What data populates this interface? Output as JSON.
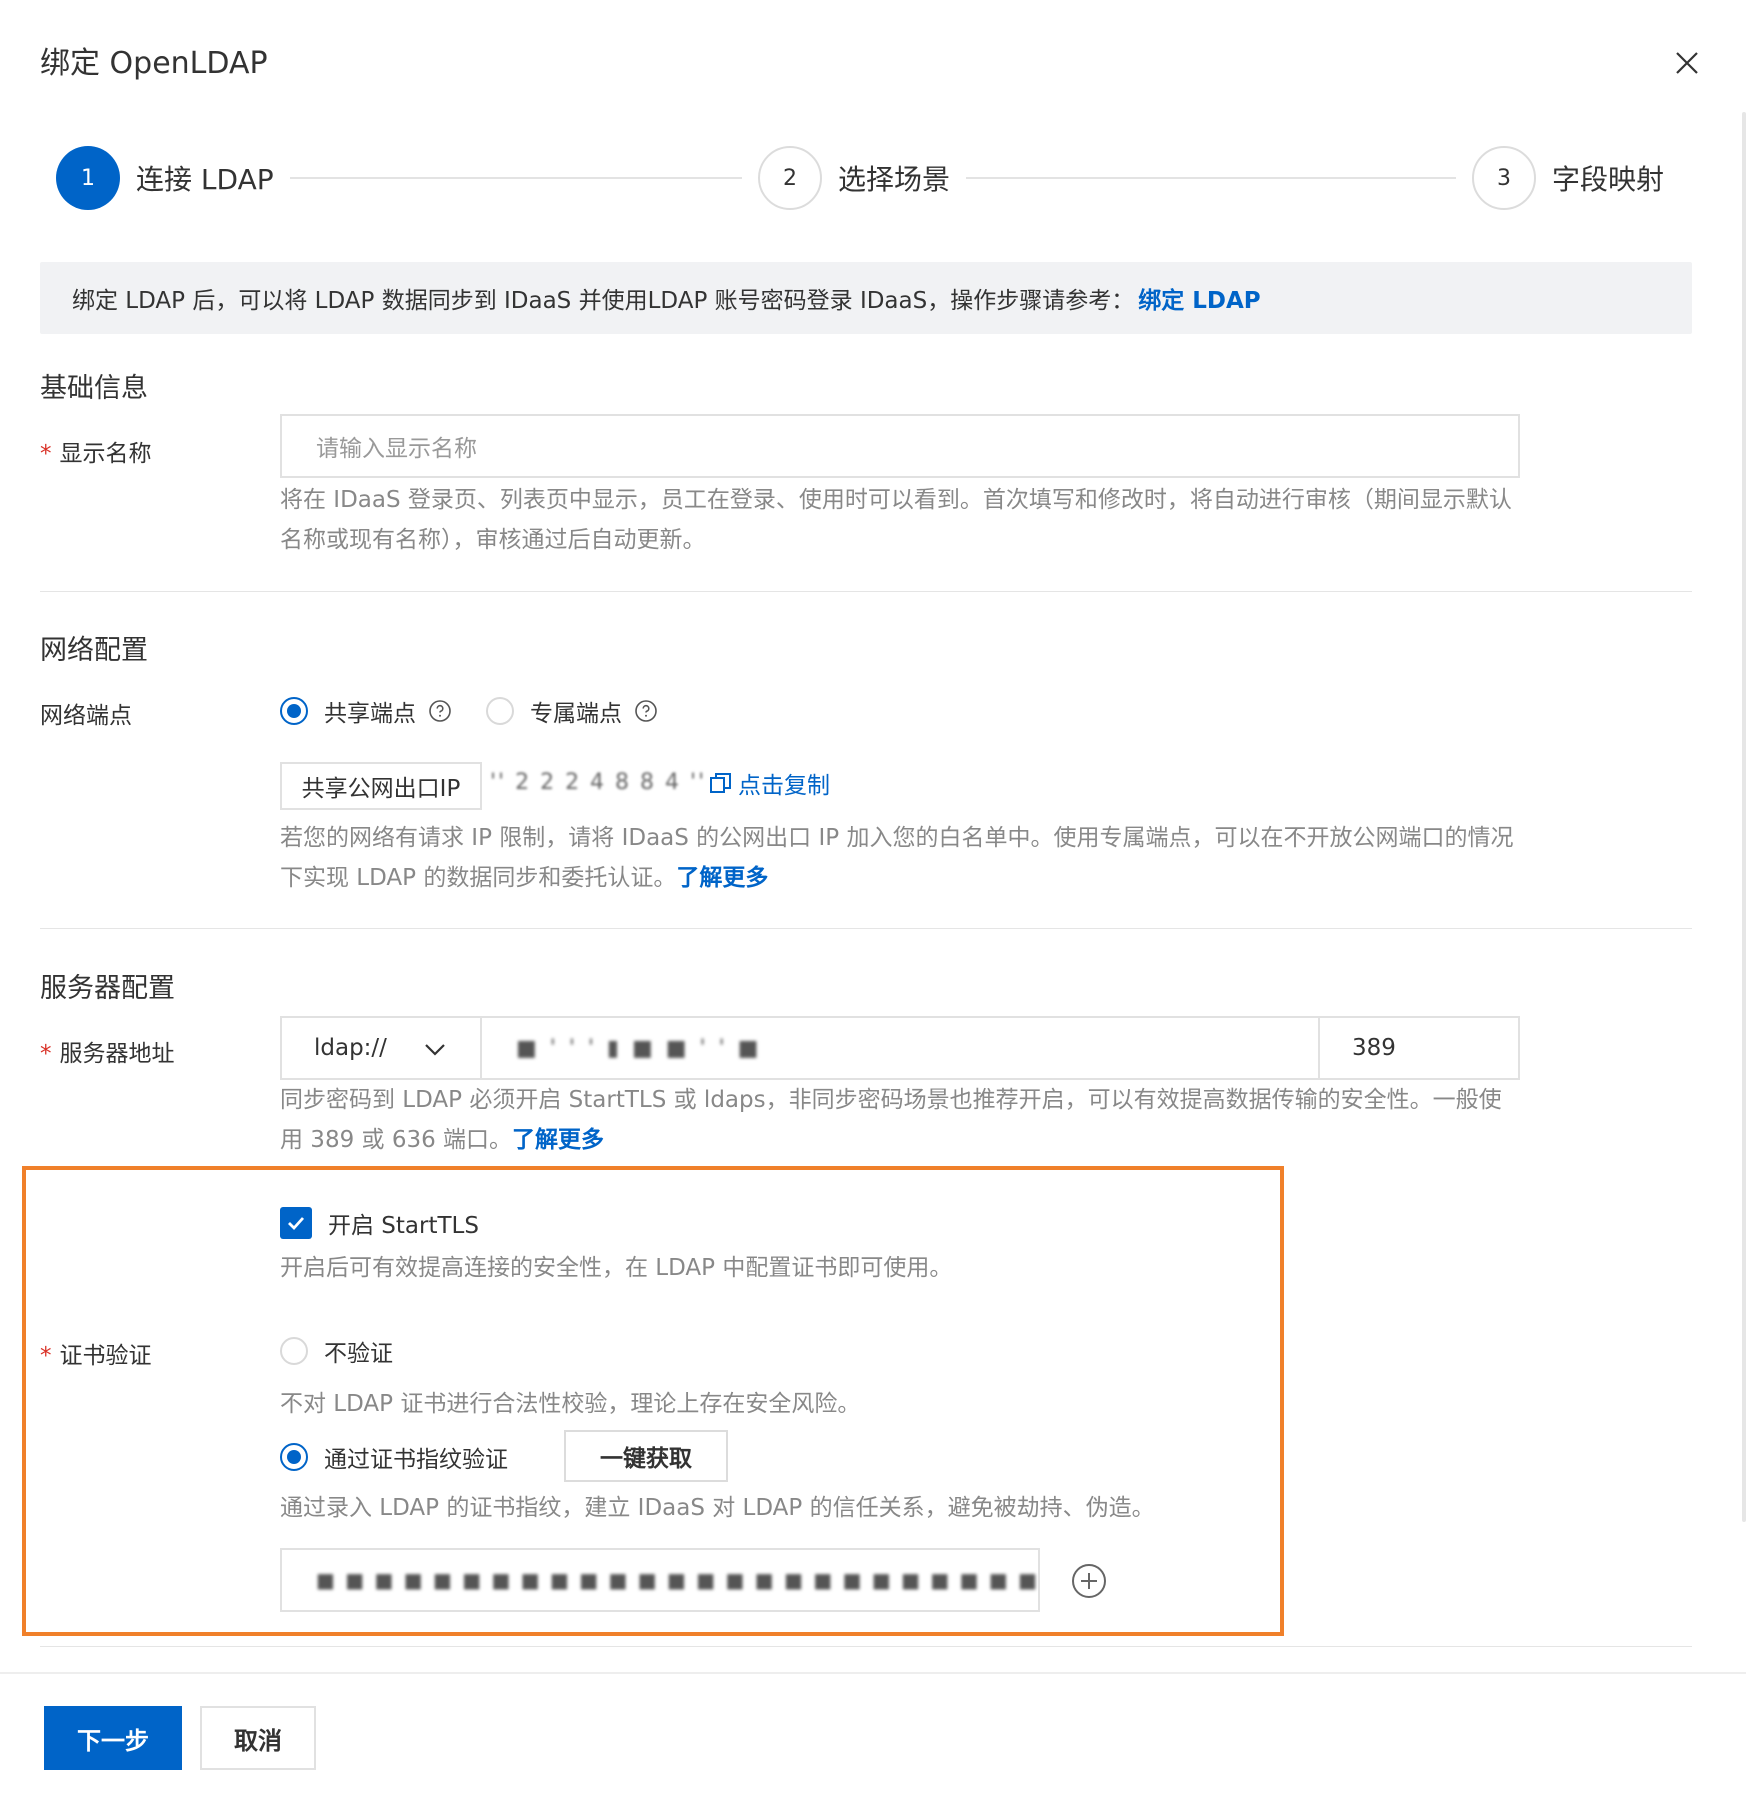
{
  "dialog": {
    "title": "绑定 OpenLDAP"
  },
  "steps": [
    {
      "number": "1",
      "label": "连接 LDAP"
    },
    {
      "number": "2",
      "label": "选择场景"
    },
    {
      "number": "3",
      "label": "字段映射"
    }
  ],
  "banner": {
    "text": "绑定 LDAP 后，可以将 LDAP 数据同步到 IDaaS 并使用LDAP 账号密码登录 IDaaS，操作步骤请参考：",
    "link": "绑定 LDAP"
  },
  "basic": {
    "section_title": "基础信息",
    "display_name_label": "显示名称",
    "display_name_placeholder": "请输入显示名称",
    "display_name_help": "将在 IDaaS 登录页、列表页中显示，员工在登录、使用时可以看到。首次填写和修改时，将自动进行审核（期间显示默认名称或现有名称），审核通过后自动更新。"
  },
  "network": {
    "section_title": "网络配置",
    "endpoint_label": "网络端点",
    "shared_option": "共享端点",
    "dedicated_option": "专属端点",
    "egress_tag": "共享公网出口IP",
    "egress_ip_masked": "'' 2 2 2 4 8 8 4 ''",
    "copy_link": "点击复制",
    "help_text": "若您的网络有请求 IP 限制，请将 IDaaS 的公网出口 IP 加入您的白名单中。使用专属端点，可以在不开放公网端口的情况下实现 LDAP 的数据同步和委托认证。",
    "help_link": "了解更多"
  },
  "server": {
    "section_title": "服务器配置",
    "address_label": "服务器地址",
    "protocol": "ldap://",
    "host_masked": "■ ' ' ' ▮ ■ ■ ' ' ■",
    "port": "389",
    "help_text": "同步密码到 LDAP 必须开启 StartTLS 或 ldaps，非同步密码场景也推荐开启，可以有效提高数据传输的安全性。一般使用 389 或 636 端口。",
    "help_link": "了解更多",
    "starttls_label": "开启 StartTLS",
    "starttls_help": "开启后可有效提高连接的安全性，在 LDAP 中配置证书即可使用。",
    "cert_label": "证书验证",
    "no_verify_option": "不验证",
    "no_verify_help": "不对 LDAP 证书进行合法性校验，理论上存在安全风险。",
    "fingerprint_option": "通过证书指纹验证",
    "fetch_button": "一键获取",
    "fingerprint_help": "通过录入 LDAP 的证书指纹，建立 IDaaS 对 LDAP 的信任关系，避免被劫持、伪造。",
    "fingerprint_masked": "■ ■ ■ ■ ■ ■ ■ ■ ■ ■ ■ ■ ■ ■ ■ ■ ■ ■ ■ ■ ■ ■ ■ ■ ■ ■ ■ ■ ■"
  },
  "footer": {
    "next_button": "下一步",
    "cancel_button": "取消"
  },
  "colors": {
    "primary": "#0064c8",
    "highlight": "#f0802a",
    "required": "#d93026"
  }
}
